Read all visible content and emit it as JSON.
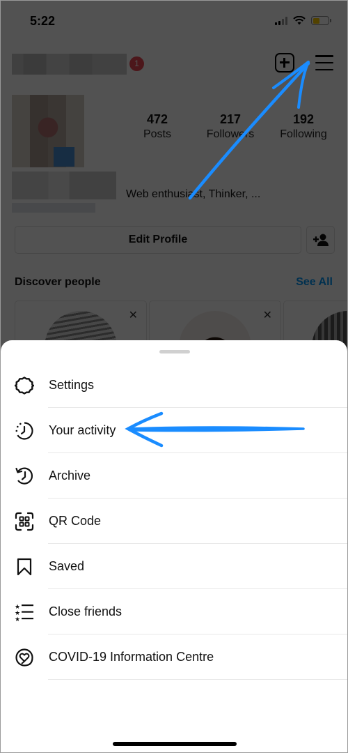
{
  "status_bar": {
    "time": "5:22"
  },
  "profile": {
    "notification_count": "1",
    "stats": [
      {
        "value": "472",
        "label": "Posts"
      },
      {
        "value": "217",
        "label": "Followers"
      },
      {
        "value": "192",
        "label": "Following"
      }
    ],
    "bio": "Web enthusiast, Thinker, ...",
    "edit_profile_label": "Edit Profile",
    "discover": {
      "title": "Discover people",
      "see_all_label": "See All"
    }
  },
  "colors": {
    "accent": "#0095f6",
    "annotation_arrow": "#1a8cff",
    "badge": "#ed4956"
  },
  "menu": {
    "items": [
      {
        "label": "Settings",
        "icon": "gear-icon"
      },
      {
        "label": "Your activity",
        "icon": "activity-clock-icon"
      },
      {
        "label": "Archive",
        "icon": "archive-history-icon"
      },
      {
        "label": "QR Code",
        "icon": "qr-code-icon"
      },
      {
        "label": "Saved",
        "icon": "bookmark-icon"
      },
      {
        "label": "Close friends",
        "icon": "close-friends-list-icon"
      },
      {
        "label": "COVID-19 Information Centre",
        "icon": "covid-heart-icon"
      }
    ]
  }
}
